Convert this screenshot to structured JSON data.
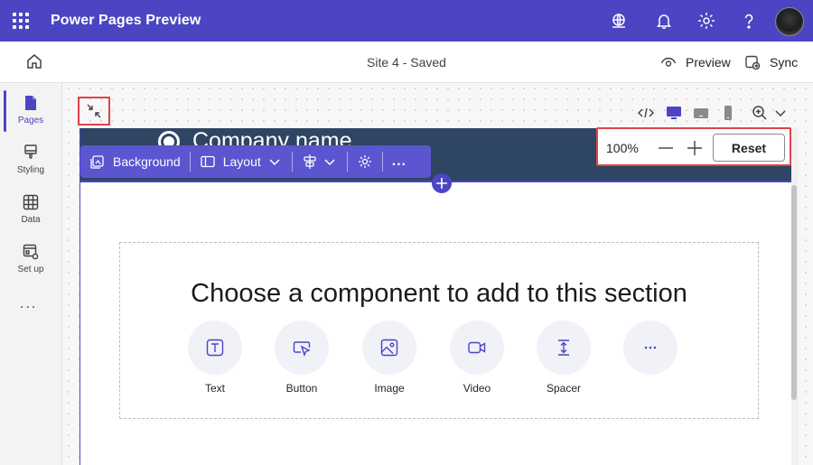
{
  "app": {
    "title": "Power Pages Preview"
  },
  "topbar": {
    "icons": [
      "waffle-icon",
      "environment-icon",
      "bell-icon",
      "gear-icon",
      "help-icon",
      "avatar"
    ]
  },
  "command_bar": {
    "site_status": "Site 4 - Saved",
    "preview_label": "Preview",
    "sync_label": "Sync"
  },
  "rail": {
    "items": [
      {
        "label": "Pages",
        "icon": "pages-icon",
        "active": true
      },
      {
        "label": "Styling",
        "icon": "brush-icon",
        "active": false
      },
      {
        "label": "Data",
        "icon": "table-icon",
        "active": false
      },
      {
        "label": "Set up",
        "icon": "setup-icon",
        "active": false
      }
    ],
    "more_label": "..."
  },
  "header": {
    "company_name": "Company name"
  },
  "section_toolbar": {
    "background_label": "Background",
    "layout_label": "Layout",
    "more_label": "..."
  },
  "zoom": {
    "level": "100%",
    "reset_label": "Reset"
  },
  "picker": {
    "title": "Choose a component to add to this section",
    "components": [
      {
        "label": "Text",
        "icon": "text-icon"
      },
      {
        "label": "Button",
        "icon": "button-icon"
      },
      {
        "label": "Image",
        "icon": "image-icon"
      },
      {
        "label": "Video",
        "icon": "video-icon"
      },
      {
        "label": "Spacer",
        "icon": "spacer-icon"
      },
      {
        "label": "",
        "icon": "more-icon"
      }
    ]
  },
  "colors": {
    "brand": "#4b45c3",
    "header_band": "#2e4563",
    "highlight": "#e0444a"
  }
}
